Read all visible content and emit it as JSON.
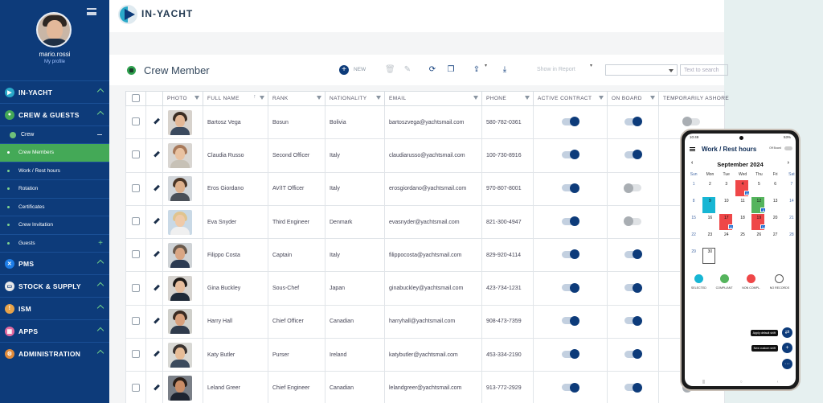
{
  "user": {
    "name": "mario.rossi",
    "profile_link": "My profile"
  },
  "sidebar": {
    "sections": [
      {
        "label": "IN-YACHT",
        "icon": "yacht-icon",
        "color": "#2aa9c9"
      },
      {
        "label": "CREW & GUESTS",
        "icon": "crew-icon",
        "color": "#44a957"
      }
    ],
    "crew_label": "Crew",
    "crew_items": [
      "Crew Members",
      "Work / Rest hours",
      "Rotation",
      "Certificates",
      "Crew Invitation"
    ],
    "guests_label": "Guests",
    "bottom_sections": [
      {
        "label": "PMS",
        "icon": "pms-icon",
        "color": "#1e7ee8"
      },
      {
        "label": "STOCK & SUPPLY",
        "icon": "stock-icon",
        "color": "#e9e9e9"
      },
      {
        "label": "ISM",
        "icon": "ism-icon",
        "color": "#e7a34a"
      },
      {
        "label": "APPS",
        "icon": "apps-icon",
        "color": "#e26aa0"
      },
      {
        "label": "ADMINISTRATION",
        "icon": "admin-icon",
        "color": "#e08a3a"
      }
    ]
  },
  "header": {
    "brand": "IN-YACHT"
  },
  "toolbar": {
    "title": "Crew Member",
    "new_label": "NEW",
    "show_in_report": "Show in Report",
    "search_placeholder": "Text to search"
  },
  "table": {
    "columns": [
      "PHOTO",
      "FULL NAME",
      "RANK",
      "NATIONALITY",
      "EMAIL",
      "PHONE",
      "ACTIVE CONTRACT",
      "ON BOARD",
      "TEMPORARILY ASHORE"
    ],
    "rows": [
      {
        "name": "Bartosz Vega",
        "rank": "Bosun",
        "nationality": "Bolivia",
        "email": "bartoszvega@yachtsmail.com",
        "phone": "580-782-0361",
        "active": true,
        "onboard": true,
        "ashore": false
      },
      {
        "name": "Claudia Russo",
        "rank": "Second Officer",
        "nationality": "Italy",
        "email": "claudiarusso@yachtsmail.com",
        "phone": "100-730-8916",
        "active": true,
        "onboard": true,
        "ashore": false
      },
      {
        "name": "Eros Giordano",
        "rank": "AV/IT Officer",
        "nationality": "Italy",
        "email": "erosgiordano@yachtsmail.com",
        "phone": "970-807-8001",
        "active": true,
        "onboard": false,
        "ashore": false
      },
      {
        "name": "Eva Snyder",
        "rank": "Third Engineer",
        "nationality": "Denmark",
        "email": "evasnyder@yachtsmail.com",
        "phone": "821-300-4947",
        "active": true,
        "onboard": false,
        "ashore": false
      },
      {
        "name": "Filippo Costa",
        "rank": "Captain",
        "nationality": "Italy",
        "email": "filippocosta@yachtsmail.com",
        "phone": "829-920-4114",
        "active": true,
        "onboard": true,
        "ashore": false
      },
      {
        "name": "Gina Buckley",
        "rank": "Sous-Chef",
        "nationality": "Japan",
        "email": "ginabuckley@yachtsmail.com",
        "phone": "423-734-1231",
        "active": true,
        "onboard": true,
        "ashore": false
      },
      {
        "name": "Harry Hall",
        "rank": "Chief Officer",
        "nationality": "Canadian",
        "email": "harryhall@yachtsmail.com",
        "phone": "908-473-7359",
        "active": true,
        "onboard": true,
        "ashore": false
      },
      {
        "name": "Katy Butler",
        "rank": "Purser",
        "nationality": "Ireland",
        "email": "katybutler@yachtsmail.com",
        "phone": "453-334-2190",
        "active": true,
        "onboard": true,
        "ashore": false
      },
      {
        "name": "Leland Greer",
        "rank": "Chief Engineer",
        "nationality": "Canadian",
        "email": "lelandgreer@yachtsmail.com",
        "phone": "913-772-2929",
        "active": true,
        "onboard": true,
        "ashore": false
      }
    ]
  },
  "phone": {
    "time": "10:49",
    "battery": "53%",
    "title": "Work / Rest hours",
    "off_board": "Off Board",
    "month": "September 2024",
    "weekdays": [
      "Sun",
      "Mon",
      "Tue",
      "Wed",
      "Thu",
      "Fri",
      "Sat"
    ],
    "badges": [
      "16",
      "8",
      "16",
      "14"
    ],
    "legend": [
      "SELECTED",
      "COMPLIANT",
      "NON COMPL.",
      "NO RECORDS"
    ],
    "fab_default": "Apply default shift",
    "fab_custom": "New custom shift"
  }
}
